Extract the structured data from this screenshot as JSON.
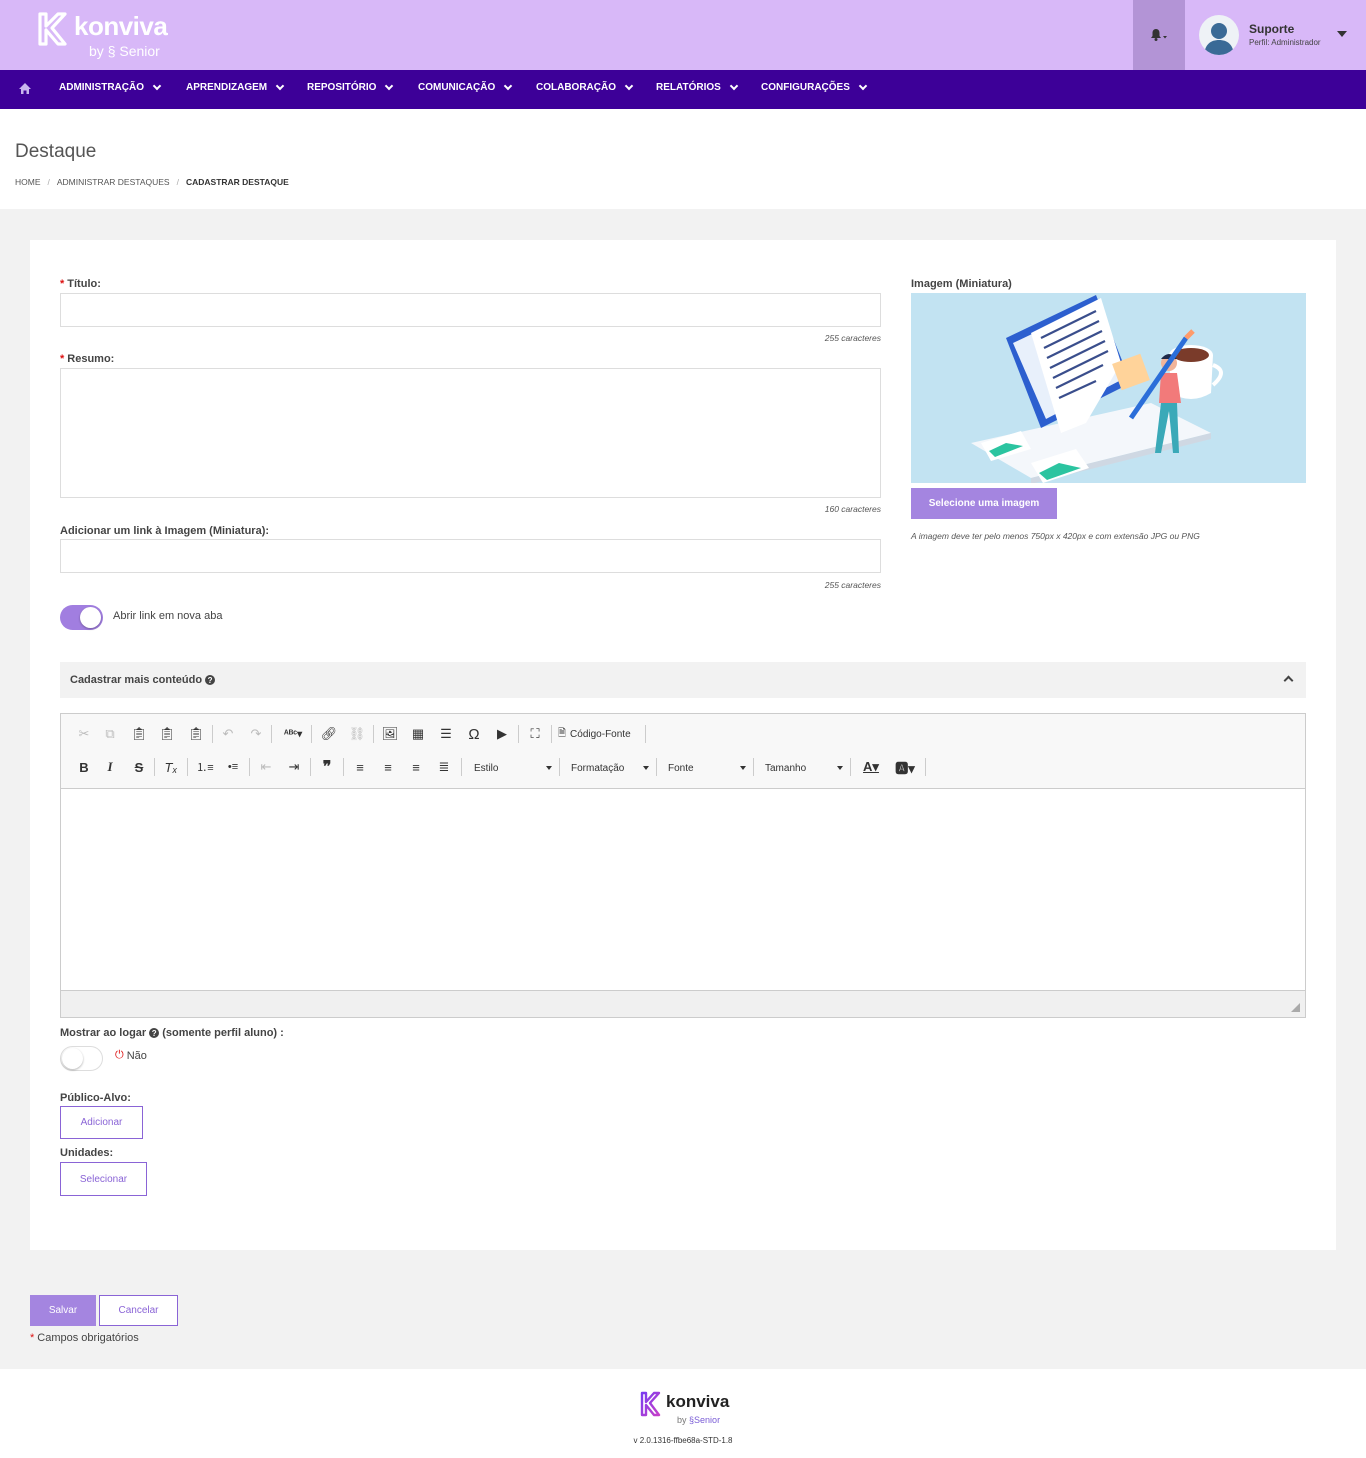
{
  "header": {
    "brand": "konviva",
    "brand_by": "by",
    "brand_sub": "Senior",
    "user": {
      "name": "Suporte",
      "role": "Perfil: Administrador"
    }
  },
  "nav": {
    "items": [
      "ADMINISTRAÇÃO",
      "APRENDIZAGEM",
      "REPOSITÓRIO",
      "COMUNICAÇÃO",
      "COLABORAÇÃO",
      "RELATÓRIOS",
      "CONFIGURAÇÕES"
    ]
  },
  "page": {
    "title": "Destaque",
    "breadcrumb": [
      "HOME",
      "ADMINISTRAR DESTAQUES",
      "CADASTRAR DESTAQUE"
    ],
    "breadcrumb_sep": "/"
  },
  "form": {
    "required_mark": "*",
    "titulo": {
      "label": "Título:",
      "value": "",
      "counter": "255 caracteres"
    },
    "resumo": {
      "label": "Resumo:",
      "value": "",
      "counter": "160 caracteres"
    },
    "link": {
      "label": "Adicionar um link à Imagem (Miniatura):",
      "value": "",
      "counter": "255 caracteres"
    },
    "nova_aba": {
      "label": "Abrir link em nova aba",
      "on": true
    },
    "imagem": {
      "label": "Imagem (Miniatura)",
      "button": "Selecione uma imagem",
      "hint": "A imagem deve ter pelo menos 750px x 420px e com extensão JPG ou PNG"
    },
    "mais_conteudo": {
      "label": "Cadastrar mais conteúdo",
      "help": "?"
    },
    "editor": {
      "source_label": "Código-Fonte",
      "combos": [
        "Estilo",
        "Formatação",
        "Fonte",
        "Tamanho"
      ]
    },
    "mostrar_logar": {
      "label_a": "Mostrar ao logar",
      "help": "?",
      "label_b": "(somente perfil aluno) :",
      "on": false,
      "state": "Não"
    },
    "publico": {
      "label": "Público-Alvo:",
      "button": "Adicionar"
    },
    "unidades": {
      "label": "Unidades:",
      "button": "Selecionar"
    }
  },
  "actions": {
    "save": "Salvar",
    "cancel": "Cancelar",
    "required_note": "Campos obrigatórios"
  },
  "footer": {
    "brand": "konviva",
    "brand_by": "by",
    "brand_sub": "Senior",
    "version": "v 2.0.1316-ffbe68a-STD-1.8"
  },
  "colors": {
    "header_bg": "#d8b8f8",
    "nav_bg": "#3d0098",
    "accent": "#a485e0",
    "required": "#dd1111"
  }
}
